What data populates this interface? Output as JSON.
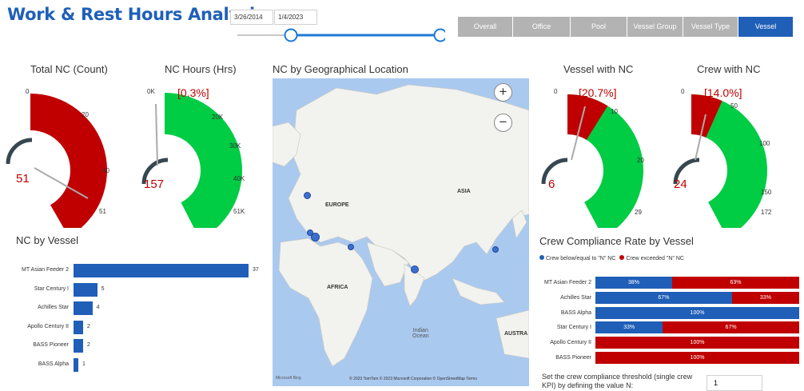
{
  "header": {
    "title": "Work & Rest Hours Analysis",
    "date_start": "3/26/2014",
    "date_end": "1/4/2023"
  },
  "tabs": [
    {
      "label": "Overall",
      "active": false
    },
    {
      "label": "Office",
      "active": false
    },
    {
      "label": "Pool",
      "active": false
    },
    {
      "label": "Vessel Group",
      "active": false
    },
    {
      "label": "Vessel Type",
      "active": false
    },
    {
      "label": "Vessel",
      "active": true
    }
  ],
  "colors": {
    "accent": "#1f5fb8",
    "red": "#c00000",
    "green": "#00cc44",
    "grey": "#b3b3b3"
  },
  "gauges": {
    "total_nc": {
      "title": "Total NC (Count)",
      "value": "51",
      "pct": "",
      "labels": [
        "0",
        "20",
        "40",
        "51"
      ]
    },
    "nc_hours": {
      "title": "NC Hours (Hrs)",
      "value": "157",
      "pct": "[0.3%]",
      "labels": [
        "0K",
        "20K",
        "30K",
        "40K",
        "51K"
      ]
    },
    "vessel_nc": {
      "title": "Vessel with NC",
      "value": "6",
      "pct": "[20.7%]",
      "labels": [
        "0",
        "10",
        "20",
        "29"
      ]
    },
    "crew_nc": {
      "title": "Crew with NC",
      "value": "24",
      "pct": "[14.0%]",
      "labels": [
        "0",
        "50",
        "100",
        "150",
        "172"
      ]
    }
  },
  "map": {
    "title": "NC by Geographical Location",
    "labels": {
      "europe": "EUROPE",
      "asia": "ASIA",
      "africa": "AFRICA",
      "indian_ocean": "Indian\nOcean",
      "austra": "AUSTRA"
    },
    "attribution": "© 2023 TomTom  © 2023 Microsoft Corporation  © OpenStreetMap  Terms",
    "bing": "Microsoft Bing",
    "zoom_in": "+",
    "zoom_out": "−"
  },
  "nc_by_vessel": {
    "title": "NC by Vessel",
    "rows": [
      {
        "name": "MT Asian Feeder 2",
        "value": 37
      },
      {
        "name": "Star Century I",
        "value": 5
      },
      {
        "name": "Achilles Star",
        "value": 4
      },
      {
        "name": "Apollo Century II",
        "value": 2
      },
      {
        "name": "BASS Pioneer",
        "value": 2
      },
      {
        "name": "BASS Alpha",
        "value": 1
      }
    ]
  },
  "crew_compliance": {
    "title": "Crew Compliance Rate by Vessel",
    "legend_blue": "Crew below/equal to \"N\" NC",
    "legend_red": "Crew exceeded \"N\" NC",
    "rows": [
      {
        "name": "MT Asian Feeder 2",
        "blue": 38,
        "red": 63,
        "blue_label": "38%",
        "red_label": "63%"
      },
      {
        "name": "Achilles Star",
        "blue": 67,
        "red": 33,
        "blue_label": "67%",
        "red_label": "33%"
      },
      {
        "name": "BASS Alpha",
        "blue": 100,
        "red": 0,
        "blue_label": "100%",
        "red_label": ""
      },
      {
        "name": "Star Century I",
        "blue": 33,
        "red": 67,
        "blue_label": "33%",
        "red_label": "67%"
      },
      {
        "name": "Apollo Century II",
        "blue": 0,
        "red": 100,
        "blue_label": "",
        "red_label": "100%"
      },
      {
        "name": "BASS Pioneer",
        "blue": 0,
        "red": 100,
        "blue_label": "",
        "red_label": "100%"
      }
    ],
    "threshold_text": "Set the crew compliance threshold (single crew KPI) by defining the value N:",
    "threshold_value": "1"
  }
}
